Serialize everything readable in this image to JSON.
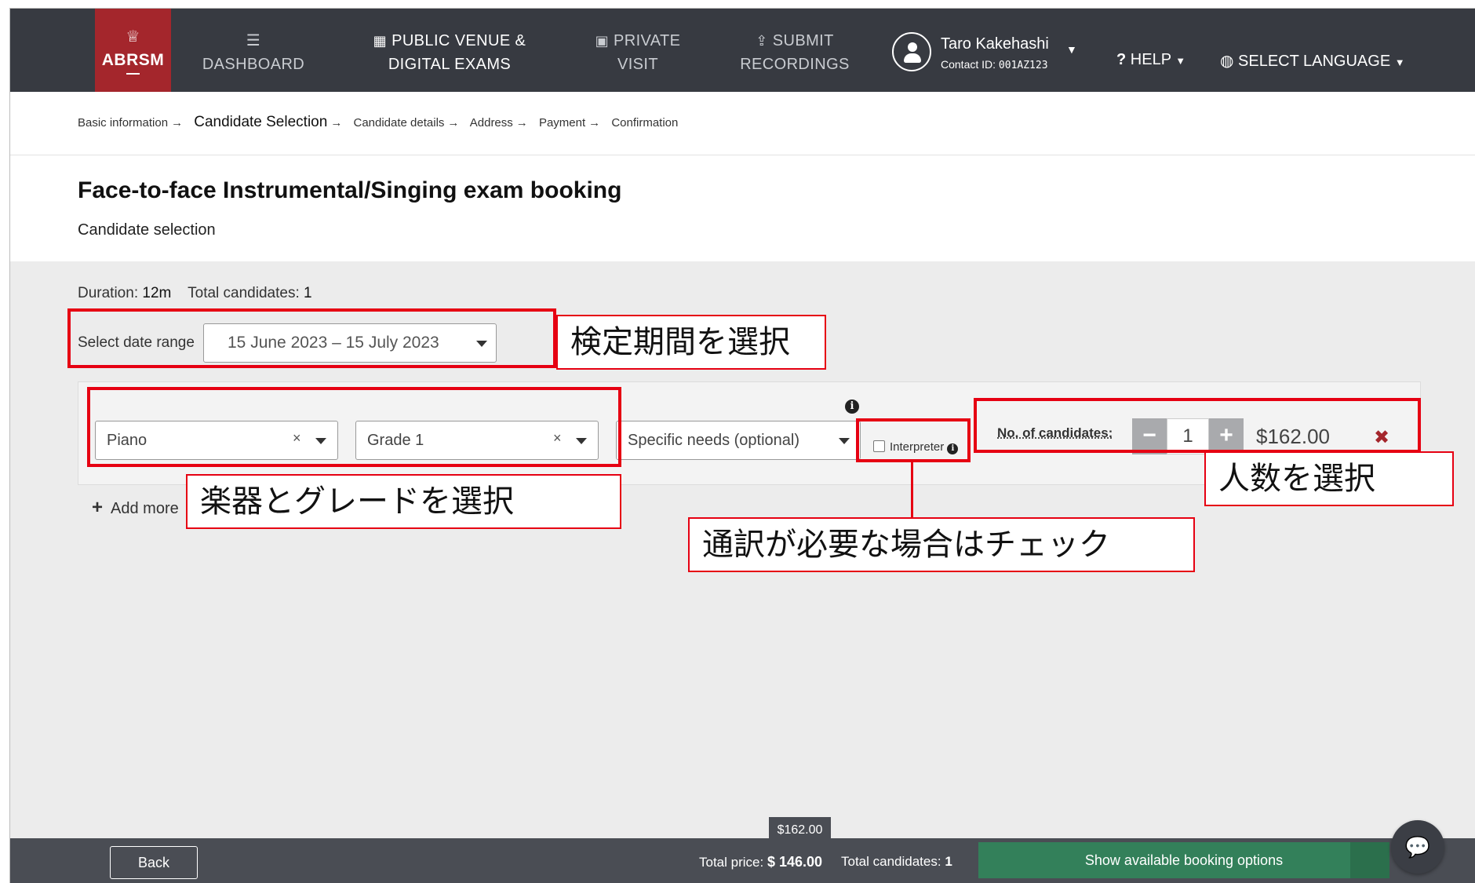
{
  "nav": {
    "logo_text": "ABRSM",
    "items": [
      {
        "label_line1": "DASHBOARD",
        "label_line2": ""
      },
      {
        "label_line1": "PUBLIC VENUE &",
        "label_line2": "DIGITAL EXAMS"
      },
      {
        "label_line1": "PRIVATE",
        "label_line2": "VISIT"
      },
      {
        "label_line1": "SUBMIT",
        "label_line2": "RECORDINGS"
      }
    ],
    "user": {
      "name": "Taro Kakehashi",
      "contact_label": "Contact ID:",
      "contact_id": "001AZ123"
    },
    "help": "HELP",
    "language": "SELECT LANGUAGE"
  },
  "breadcrumb": [
    "Basic information",
    "Candidate Selection",
    "Candidate details",
    "Address",
    "Payment",
    "Confirmation"
  ],
  "page": {
    "title": "Face-to-face Instrumental/Singing exam booking",
    "subtitle": "Candidate selection"
  },
  "meta": {
    "duration_label": "Duration:",
    "duration": "12m",
    "total_label": "Total candidates:",
    "total": "1"
  },
  "date_range": {
    "label": "Select date range",
    "value": "15 June 2023 – 15 July 2023"
  },
  "candidate_row": {
    "instrument": "Piano",
    "grade": "Grade 1",
    "specific_needs": "Specific needs (optional)",
    "interpreter_label": "Interpreter",
    "interpreter_checked": false,
    "num_label": "No. of candidates:",
    "count": "1",
    "price": "$162.00"
  },
  "add_more": "Add more",
  "annotations": {
    "date": "検定期間を選択",
    "instrument_grade": "楽器とグレードを選択",
    "interpreter": "通訳が必要な場合はチェック",
    "count": "人数を選択"
  },
  "footer": {
    "back": "Back",
    "tag_price": "$162.00",
    "total_price_label": "Total price:",
    "total_price": "$ 146.00",
    "total_candidates_label": "Total candidates:",
    "total_candidates": "1",
    "show_button": "Show available booking options"
  },
  "colors": {
    "nav_bg": "#373a41",
    "logo_bg": "#a4262c",
    "annotation_red": "#e60012",
    "cta_green": "#33805a"
  },
  "icons": [
    "crown-icon",
    "list-icon",
    "calendar-icon",
    "badge-icon",
    "upload-icon",
    "user-icon",
    "globe-icon",
    "info-icon",
    "chat-icon"
  ]
}
